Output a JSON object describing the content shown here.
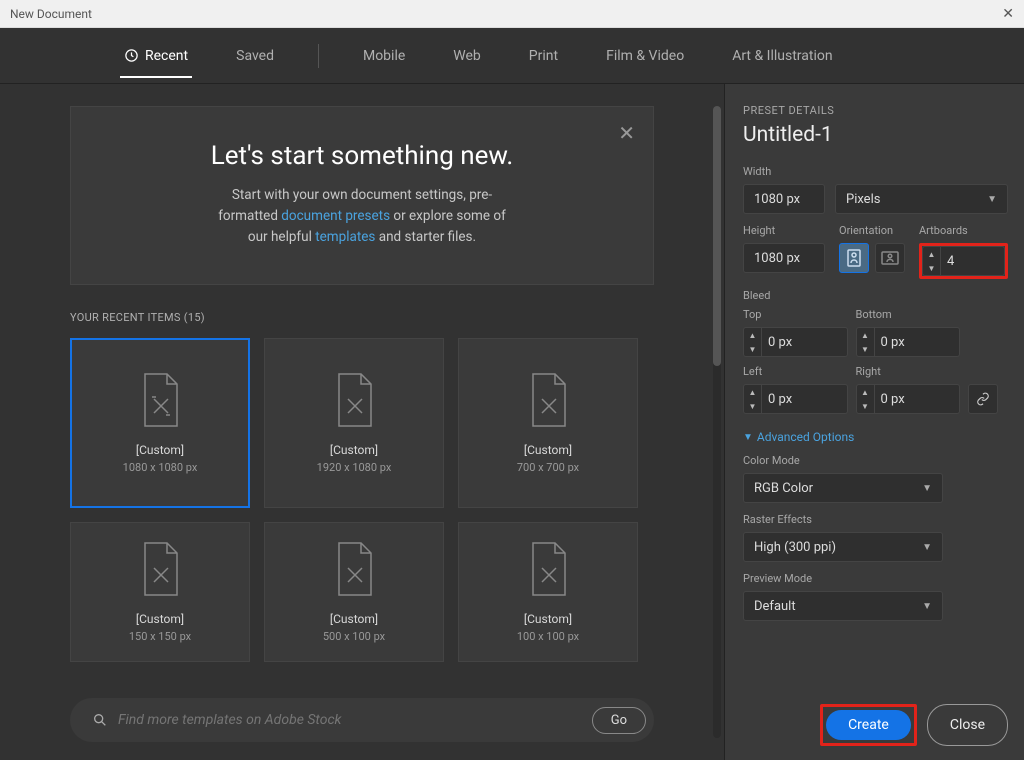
{
  "titlebar": {
    "title": "New Document"
  },
  "tabs": {
    "recent": "Recent",
    "saved": "Saved",
    "mobile": "Mobile",
    "web": "Web",
    "print": "Print",
    "film": "Film & Video",
    "art": "Art & Illustration"
  },
  "hero": {
    "title": "Let's start something new.",
    "line_a": "Start with your own document settings, pre-",
    "line_b1": "formatted ",
    "link1": "document presets",
    "line_b2": " or explore some of",
    "line_c1": "our helpful ",
    "link2": "templates",
    "line_c2": " and starter files."
  },
  "recent_section": {
    "label": "YOUR RECENT ITEMS  (15)"
  },
  "cards": [
    {
      "title": "[Custom]",
      "sub": "1080 x 1080 px"
    },
    {
      "title": "[Custom]",
      "sub": "1920 x 1080 px"
    },
    {
      "title": "[Custom]",
      "sub": "700 x 700 px"
    },
    {
      "title": "[Custom]",
      "sub": "150 x 150 px"
    },
    {
      "title": "[Custom]",
      "sub": "500 x 100 px"
    },
    {
      "title": "[Custom]",
      "sub": "100 x 100 px"
    }
  ],
  "search": {
    "placeholder": "Find more templates on Adobe Stock",
    "go": "Go"
  },
  "panel": {
    "header": "PRESET DETAILS",
    "doc_title": "Untitled-1",
    "width_label": "Width",
    "width_value": "1080 px",
    "units": "Pixels",
    "height_label": "Height",
    "height_value": "1080 px",
    "orientation_label": "Orientation",
    "artboards_label": "Artboards",
    "artboards_value": "4",
    "bleed_label": "Bleed",
    "top_label": "Top",
    "bottom_label": "Bottom",
    "left_label": "Left",
    "right_label": "Right",
    "bleed_top": "0 px",
    "bleed_bottom": "0 px",
    "bleed_left": "0 px",
    "bleed_right": "0 px",
    "advanced": "Advanced Options",
    "color_mode_label": "Color Mode",
    "color_mode": "RGB Color",
    "raster_label": "Raster Effects",
    "raster": "High (300 ppi)",
    "preview_label": "Preview Mode",
    "preview": "Default",
    "create": "Create",
    "close": "Close"
  }
}
